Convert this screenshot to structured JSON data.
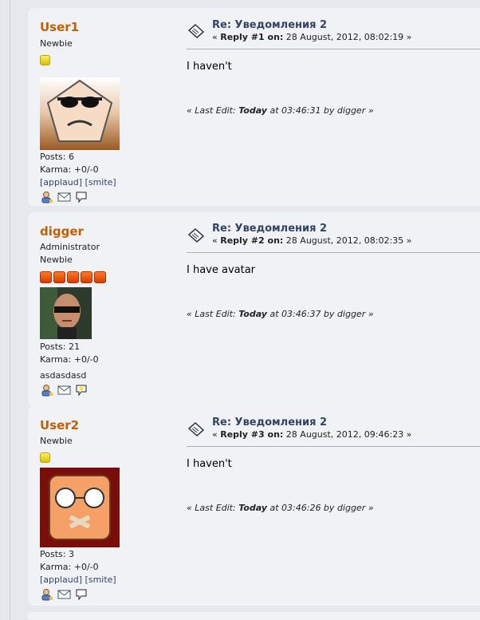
{
  "posts": [
    {
      "poster_name": "User1",
      "group": "Newbie",
      "rank": "",
      "posts_label": "Posts: 6",
      "karma_label": "Karma: +0/-0",
      "applaud": "[applaud]",
      "smite": "[smite]",
      "signature": "",
      "subject": "Re: Уведомления 2",
      "reply_prefix": "«",
      "reply_label": "Reply #1 on:",
      "reply_date": "28 August, 2012, 08:02:19",
      "reply_suffix": "»",
      "body": "I haven't",
      "edit_prefix": "« Last Edit:",
      "edit_when": "Today",
      "edit_at": "at 03:46:31 by digger »"
    },
    {
      "poster_name": "digger",
      "group": "Administrator",
      "rank": "Newbie",
      "posts_label": "Posts: 21",
      "karma_label": "Karma: +0/-0",
      "applaud": "",
      "smite": "",
      "signature": "asdasdasd",
      "subject": "Re: Уведомления 2",
      "reply_prefix": "«",
      "reply_label": "Reply #2 on:",
      "reply_date": "28 August, 2012, 08:02:35",
      "reply_suffix": "»",
      "body": "I have avatar",
      "edit_prefix": "« Last Edit:",
      "edit_when": "Today",
      "edit_at": "at 03:46:37 by digger »"
    },
    {
      "poster_name": "User2",
      "group": "Newbie",
      "rank": "",
      "posts_label": "Posts: 3",
      "karma_label": "Karma: +0/-0",
      "applaud": "[applaud]",
      "smite": "[smite]",
      "signature": "",
      "subject": "Re: Уведомления 2",
      "reply_prefix": "«",
      "reply_label": "Reply #3 on:",
      "reply_date": "28 August, 2012, 09:46:23",
      "reply_suffix": "»",
      "body": "I haven't",
      "edit_prefix": "« Last Edit:",
      "edit_when": "Today",
      "edit_at": "at 03:46:26 by digger »"
    }
  ],
  "icons": {
    "profile": "profile-icon",
    "email": "email-icon",
    "pm": "personal-message-icon",
    "topic": "topic-icon"
  },
  "colors": {
    "poster_name": "#c06002",
    "subject": "#334466",
    "post_bg": "#f0f2f6",
    "page_bg": "#e5e8ec"
  }
}
